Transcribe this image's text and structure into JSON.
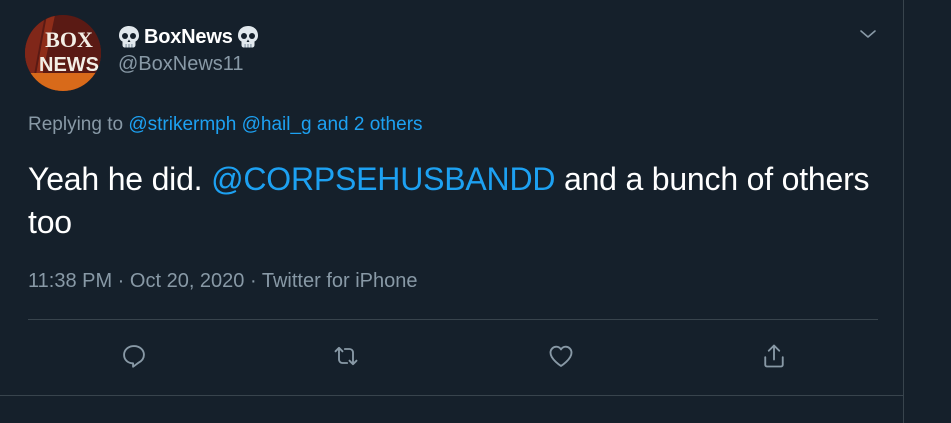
{
  "author": {
    "display_name": "BoxNews",
    "handle": "@BoxNews11",
    "name_emoji_icon": "skull-icon",
    "avatar_text_top": "BOX",
    "avatar_text_bottom": "NEWS"
  },
  "reply": {
    "prefix": "Replying to ",
    "mention_1": "@strikermph",
    "mention_2": "@hail_g",
    "others": "and 2 others"
  },
  "tweet": {
    "text_before": "Yeah he did. ",
    "mention": "@CORPSEHUSBANDD",
    "text_after": " and a bunch of others too"
  },
  "meta": {
    "time": "11:38 PM",
    "separator": " · ",
    "date": "Oct 20, 2020",
    "source": "Twitter for iPhone"
  },
  "icons": {
    "caret": "chevron-down-icon",
    "reply": "reply-icon",
    "retweet": "retweet-icon",
    "like": "heart-icon",
    "share": "share-icon"
  },
  "colors": {
    "background": "#15202b",
    "text": "#ffffff",
    "secondary": "#8899a6",
    "link": "#1da1f2",
    "border": "#38444d"
  }
}
